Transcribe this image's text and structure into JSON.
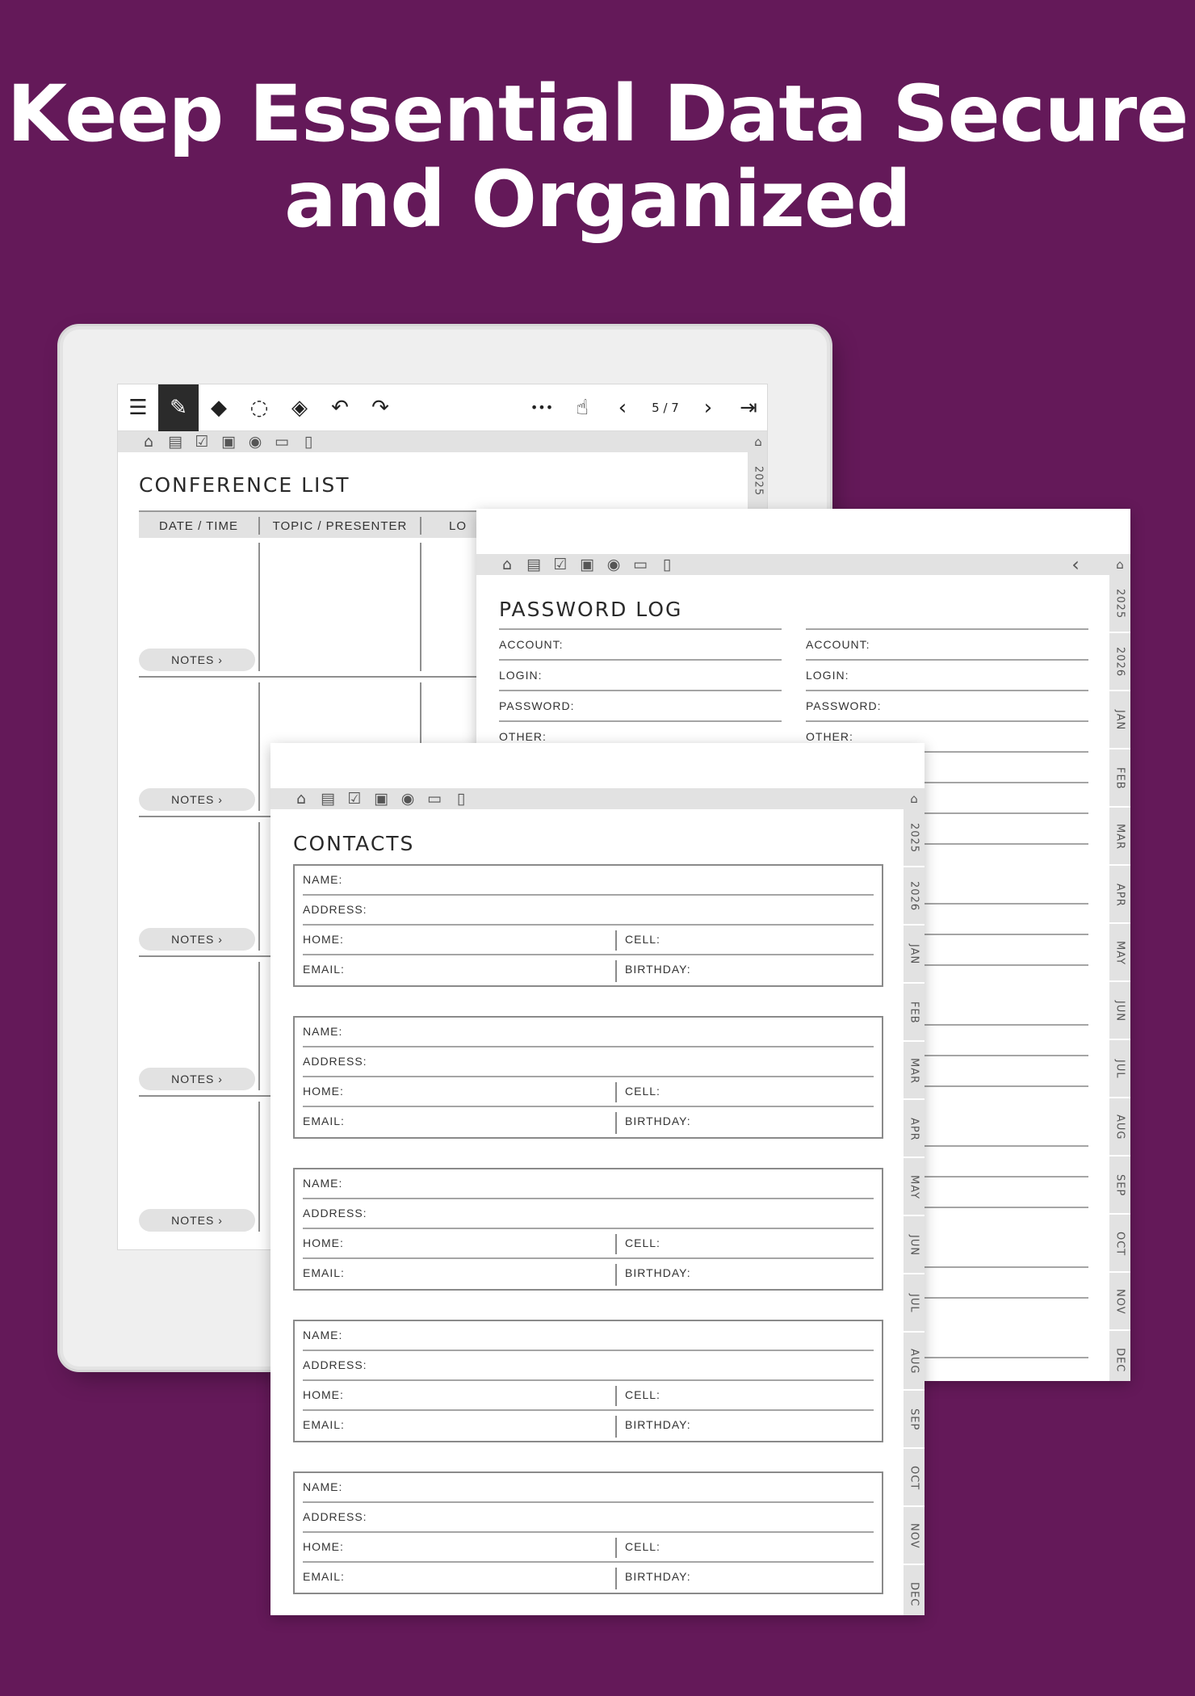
{
  "headline": {
    "line1": "Keep Essential Data Secure",
    "line2": "and Organized"
  },
  "device": {
    "toolbar": {
      "menu_icon": "☰",
      "pen_icon": "✎",
      "eraser_icon": "◆",
      "lasso_icon": "◌",
      "layers_icon": "◈",
      "undo_icon": "↶",
      "redo_icon": "↷",
      "more_icon": "•••",
      "gesture_icon": "☝",
      "prev_icon": "‹",
      "page_indicator": "5 / 7",
      "next_icon": "›",
      "exit_icon": "⇥"
    },
    "nav_icons": [
      "⌂",
      "▤",
      "☑",
      "▣",
      "◉",
      "▭",
      "▯"
    ],
    "rail_home": "⌂",
    "rail_year": "2025",
    "title": "CONFERENCE LIST",
    "columns": [
      "DATE / TIME",
      "TOPIC / PRESENTER",
      "LO"
    ],
    "notes_label": "NOTES  ›"
  },
  "password_log": {
    "nav_icons": [
      "⌂",
      "▤",
      "☑",
      "▣",
      "◉",
      "▭",
      "▯"
    ],
    "back_icon": "‹",
    "rail_home": "⌂",
    "title": "PASSWORD LOG",
    "labels": {
      "account": "ACCOUNT:",
      "login": "LOGIN:",
      "password": "PASSWORD:",
      "other": "OTHER:"
    },
    "tabs": [
      "2025",
      "2026",
      "JAN",
      "FEB",
      "MAR",
      "APR",
      "MAY",
      "JUN",
      "JUL",
      "AUG",
      "SEP",
      "OCT",
      "NOV",
      "DEC"
    ]
  },
  "contacts": {
    "nav_icons": [
      "⌂",
      "▤",
      "☑",
      "▣",
      "◉",
      "▭",
      "▯"
    ],
    "rail_home": "⌂",
    "title": "CONTACTS",
    "labels": {
      "name": "NAME:",
      "address": "ADDRESS:",
      "home": "HOME:",
      "cell": "CELL:",
      "email": "EMAIL:",
      "birthday": "BIRTHDAY:"
    },
    "tabs": [
      "2025",
      "2026",
      "JAN",
      "FEB",
      "MAR",
      "APR",
      "MAY",
      "JUN",
      "JUL",
      "AUG",
      "SEP",
      "OCT",
      "NOV",
      "DEC"
    ]
  }
}
